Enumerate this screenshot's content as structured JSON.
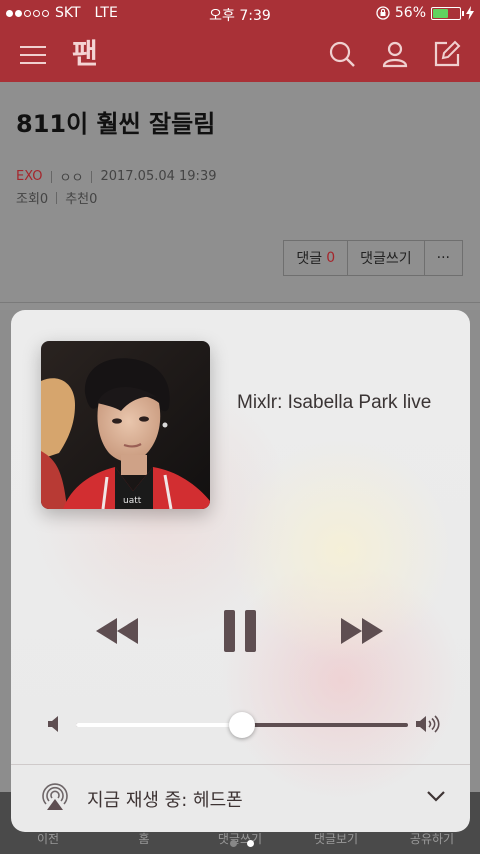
{
  "status_bar": {
    "carrier": "SKT",
    "network": "LTE",
    "time": "오후 7:39",
    "battery": "56%",
    "battery_level": 0.56
  },
  "app": {
    "logo_text": "팬"
  },
  "post": {
    "title": "811이 훨씬 잘들림",
    "category": "EXO",
    "author": "ㅇㅇ",
    "date": "2017.05.04 19:39",
    "views_label": "조회",
    "views": "0",
    "likes_label": "추천",
    "likes": "0",
    "comment_label": "댓글",
    "comment_count": "0",
    "write_comment_label": "댓글쓰기",
    "more_label": "···"
  },
  "bottom_nav": {
    "items": [
      "이전",
      "홈",
      "댓글쓰기",
      "댓글보기",
      "공유하기"
    ]
  },
  "now_playing": {
    "title": "Mixlr: Isabella Park live",
    "volume": 0.5,
    "route_label": "지금 재생 중: 헤드폰"
  },
  "colors": {
    "brand": "#a93137",
    "card_bg": "#ececec",
    "control": "#5e4e51"
  }
}
